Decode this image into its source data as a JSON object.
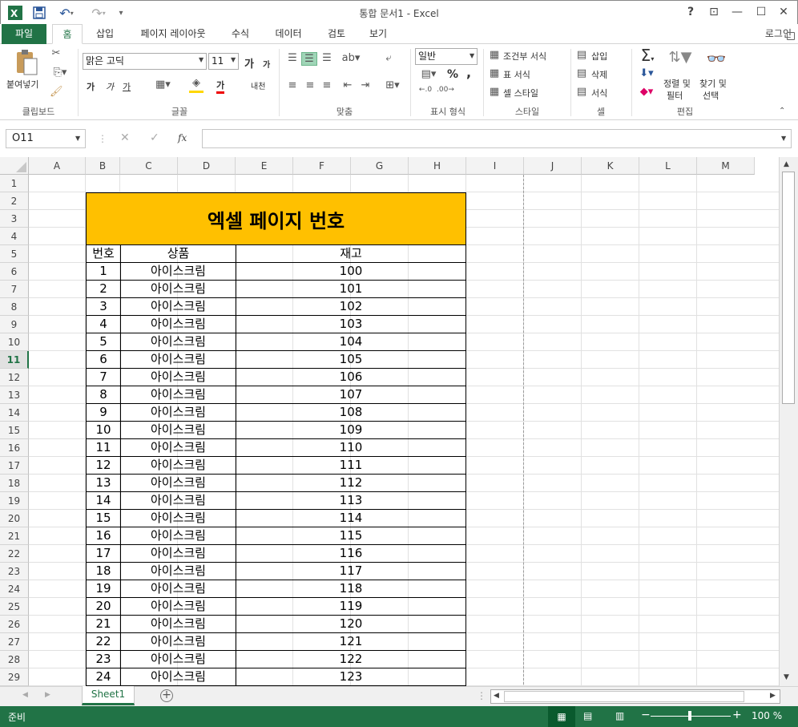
{
  "app": {
    "title": "통합 문서1 - Excel",
    "accent": "#217346",
    "qat": [
      "excel-logo-icon",
      "save-icon",
      "undo-icon",
      "redo-icon",
      "customize-icon"
    ],
    "window_controls": {
      "help": "?",
      "restore_ribbon": "⊡",
      "minimize": "—",
      "maximize": "☐",
      "close": "✕"
    }
  },
  "tabs": [
    "파일",
    "홈",
    "삽입",
    "페이지 레이아웃",
    "수식",
    "데이터",
    "검토",
    "보기"
  ],
  "login": "로그인",
  "ribbon": {
    "clipboard": {
      "paste": "붙여넣기",
      "label": "클립보드"
    },
    "font": {
      "name": "맑은 고딕",
      "size": "11",
      "label": "글꼴",
      "bold": "가",
      "italic": "가",
      "underline": "가",
      "grow": "가",
      "shrink": "가",
      "fontcolor": "가",
      "phonetic": "내천"
    },
    "align": {
      "label": "맞춤"
    },
    "number": {
      "format": "일반",
      "label": "표시 형식",
      "percent": "%",
      "comma": ","
    },
    "styles": {
      "conditional": "조건부 서식",
      "table": "표 서식",
      "cell": "셀 스타일",
      "label": "스타일"
    },
    "cells": {
      "insert": "삽입",
      "delete": "삭제",
      "format": "서식",
      "label": "셀"
    },
    "editing": {
      "sort": "정렬 및",
      "sort2": "필터",
      "find": "찾기 및",
      "find2": "선택",
      "label": "편집"
    }
  },
  "formula": {
    "namebox": "O11",
    "fx": "fx",
    "value": ""
  },
  "columns": [
    "A",
    "B",
    "C",
    "D",
    "E",
    "F",
    "G",
    "H",
    "I",
    "J",
    "K",
    "L",
    "M"
  ],
  "rows": [
    "1",
    "2",
    "3",
    "4",
    "5",
    "6",
    "7",
    "8",
    "9",
    "10",
    "11",
    "12",
    "13",
    "14",
    "15",
    "16",
    "17",
    "18",
    "19",
    "20",
    "21",
    "22",
    "23",
    "24",
    "25",
    "26",
    "27",
    "28",
    "29"
  ],
  "sheet": {
    "title": "엑셀 페이지 번호",
    "title_bg": "#FFC000",
    "headers": [
      "번호",
      "상품",
      "재고"
    ],
    "data": [
      [
        "1",
        "아이스크림",
        "100"
      ],
      [
        "2",
        "아이스크림",
        "101"
      ],
      [
        "3",
        "아이스크림",
        "102"
      ],
      [
        "4",
        "아이스크림",
        "103"
      ],
      [
        "5",
        "아이스크림",
        "104"
      ],
      [
        "6",
        "아이스크림",
        "105"
      ],
      [
        "7",
        "아이스크림",
        "106"
      ],
      [
        "8",
        "아이스크림",
        "107"
      ],
      [
        "9",
        "아이스크림",
        "108"
      ],
      [
        "10",
        "아이스크림",
        "109"
      ],
      [
        "11",
        "아이스크림",
        "110"
      ],
      [
        "12",
        "아이스크림",
        "111"
      ],
      [
        "13",
        "아이스크림",
        "112"
      ],
      [
        "14",
        "아이스크림",
        "113"
      ],
      [
        "15",
        "아이스크림",
        "114"
      ],
      [
        "16",
        "아이스크림",
        "115"
      ],
      [
        "17",
        "아이스크림",
        "116"
      ],
      [
        "18",
        "아이스크림",
        "117"
      ],
      [
        "19",
        "아이스크림",
        "118"
      ],
      [
        "20",
        "아이스크림",
        "119"
      ],
      [
        "21",
        "아이스크림",
        "120"
      ],
      [
        "22",
        "아이스크림",
        "121"
      ],
      [
        "23",
        "아이스크림",
        "122"
      ],
      [
        "24",
        "아이스크림",
        "123"
      ]
    ]
  },
  "sheet_tab": "Sheet1",
  "status": {
    "ready": "준비",
    "zoom": "100 %"
  }
}
